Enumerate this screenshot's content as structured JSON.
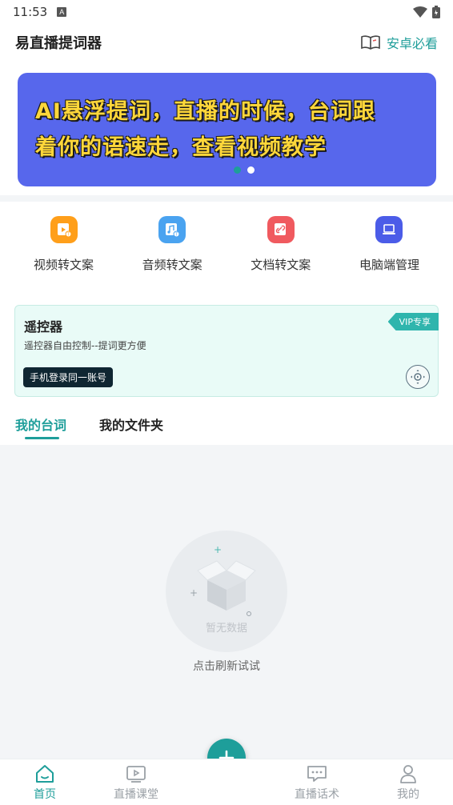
{
  "status_bar": {
    "time": "11:53",
    "badge": "A"
  },
  "header": {
    "title": "易直播提词器",
    "guide_label": "安卓必看"
  },
  "banner": {
    "line1": "AI悬浮提词，直播的时候，台词跟",
    "line2": "着你的语速走，查看视频教学"
  },
  "features": [
    {
      "label": "视频转文案",
      "icon": "video-file-icon",
      "color": "#ff9f1a"
    },
    {
      "label": "音频转文案",
      "icon": "music-file-icon",
      "color": "#4aa3f0"
    },
    {
      "label": "文档转文案",
      "icon": "link-file-icon",
      "color": "#f05a5f"
    },
    {
      "label": "电脑端管理",
      "icon": "laptop-icon",
      "color": "#4b5ce8"
    }
  ],
  "remote": {
    "title": "遥控器",
    "desc": "遥控器自由控制--提词更方便",
    "vip": "VIP专享",
    "login": "手机登录同一账号"
  },
  "tabs": {
    "mine": "我的台词",
    "folder": "我的文件夹"
  },
  "empty": {
    "label": "暂无数据",
    "refresh": "点击刷新试试"
  },
  "nav": {
    "home": "首页",
    "course": "直播课堂",
    "scripts": "直播话术",
    "me": "我的"
  },
  "colors": {
    "accent": "#1e9e9a",
    "banner_bg": "#5767ec",
    "banner_text": "#ffd73a"
  }
}
